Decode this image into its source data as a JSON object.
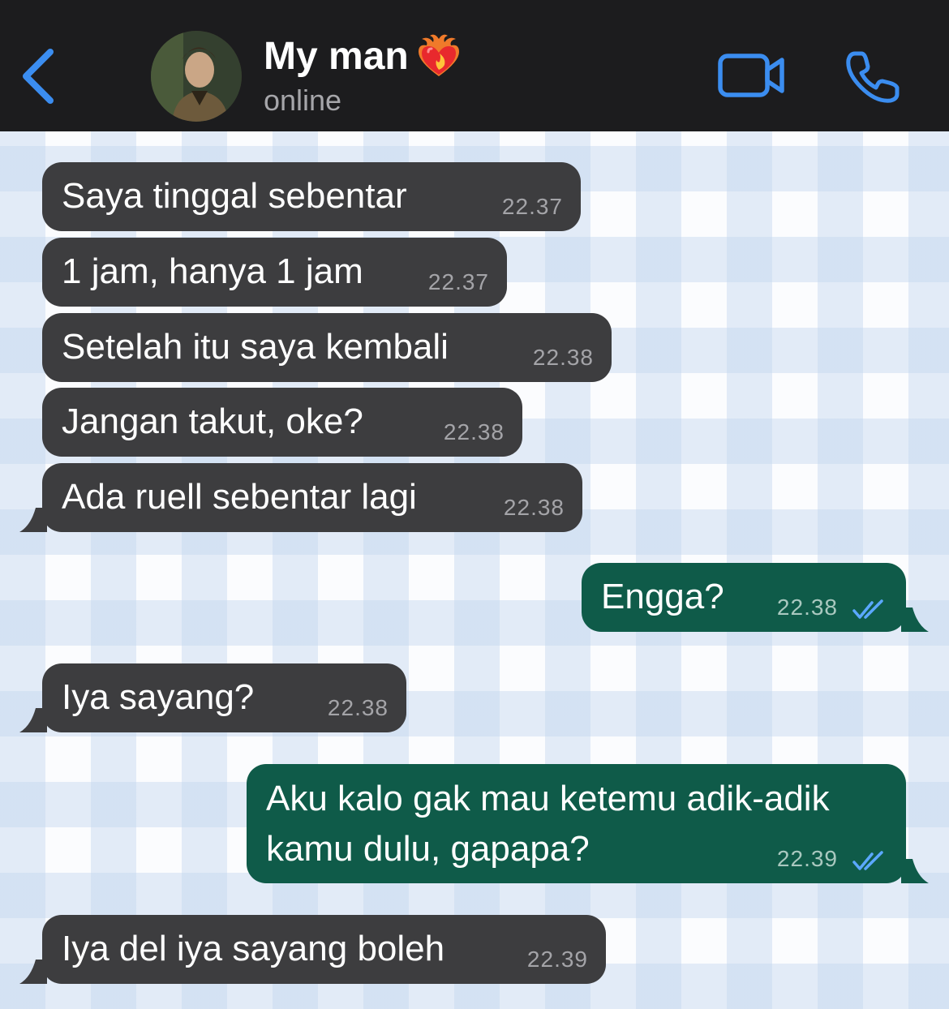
{
  "header": {
    "contact_name": "My man",
    "status": "online",
    "back_icon": "chevron-left-icon",
    "video_icon": "video-camera-icon",
    "call_icon": "phone-icon",
    "heart_icon": "heart-on-fire-emoji",
    "accent_color": "#3b8df0"
  },
  "messages": [
    {
      "direction": "incoming",
      "text": "Saya tinggal sebentar",
      "time": "22.37"
    },
    {
      "direction": "incoming",
      "text": "1 jam, hanya 1 jam",
      "time": "22.37"
    },
    {
      "direction": "incoming",
      "text": "Setelah itu saya kembali",
      "time": "22.38"
    },
    {
      "direction": "incoming",
      "text": "Jangan takut, oke?",
      "time": "22.38"
    },
    {
      "direction": "incoming",
      "text": "Ada ruell sebentar lagi",
      "time": "22.38"
    },
    {
      "direction": "outgoing",
      "text": "Engga?",
      "time": "22.38",
      "read": true
    },
    {
      "direction": "incoming",
      "text": "Iya sayang?",
      "time": "22.38"
    },
    {
      "direction": "outgoing",
      "text": "Aku kalo gak mau ketemu adik-adik\nkamu dulu, gapapa?",
      "time": "22.39",
      "read": true
    },
    {
      "direction": "incoming",
      "text": "Iya del iya sayang boleh",
      "time": "22.39"
    }
  ],
  "colors": {
    "header_bg": "#1c1c1e",
    "incoming_bubble": "#3d3d3f",
    "outgoing_bubble": "#0f5b49",
    "read_check": "#5ba8ff"
  }
}
